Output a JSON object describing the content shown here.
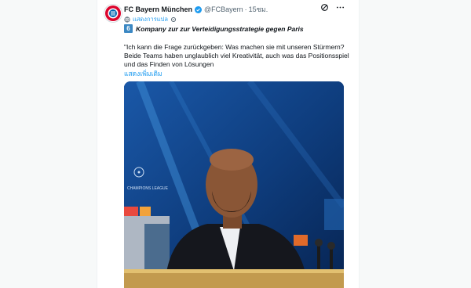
{
  "post": {
    "author_name": "FC Bayern München",
    "handle": "@FCBayern",
    "separator": "·",
    "time": "15ชม.",
    "sub_link": "แสดงการแปล",
    "number_badge": "6",
    "headline": "Kompany zur zur Verteidigungsstrategie gegen Paris",
    "body": "\"Ich kann die Frage zurückgeben: Was machen sie mit unseren Stürmern? Beide Teams haben unglaublich viel Kreativität, auch was das Positionsspiel und das Finden von Lösungen",
    "show_more": "แสดงเพิ่มเติม"
  },
  "icons": {
    "verified": "verified-badge-icon",
    "grok": "grok-icon",
    "more": "more-icon",
    "settings": "gear-icon"
  },
  "media": {
    "banner_text": "CHAMPIONS LEAGUE"
  },
  "colors": {
    "accent": "#1d9bf0",
    "badge_blue": "#3b88c3",
    "bayern_red": "#dc052d"
  }
}
